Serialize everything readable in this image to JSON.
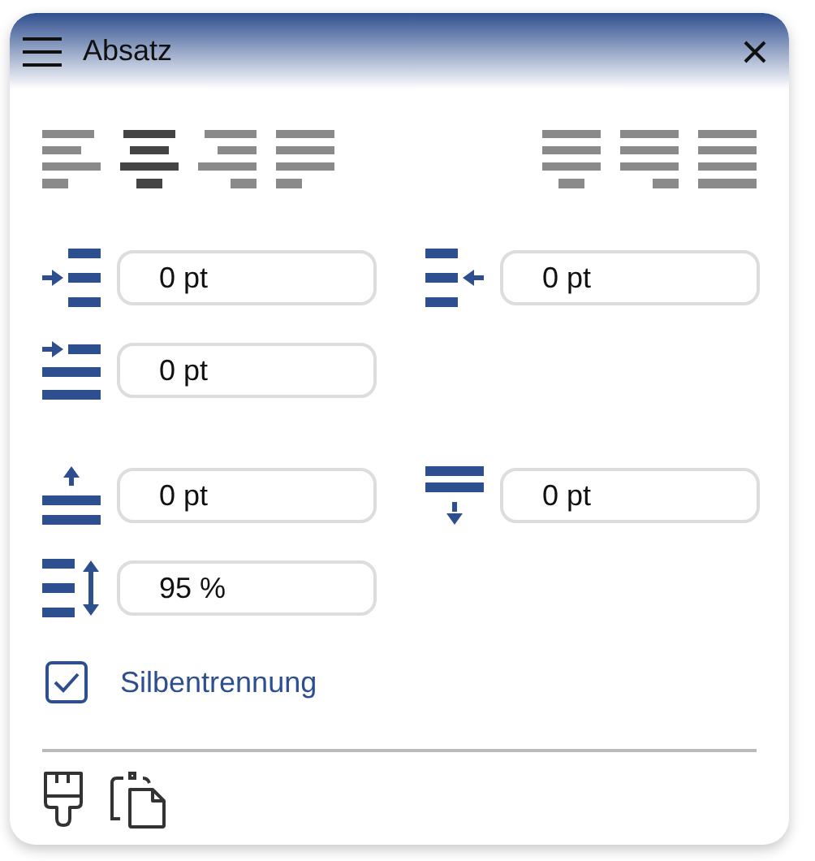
{
  "panel": {
    "title": "Absatz"
  },
  "alignment": [
    {
      "kind": "left",
      "selected": false
    },
    {
      "kind": "center",
      "selected": true
    },
    {
      "kind": "right",
      "selected": false
    },
    {
      "kind": "justify",
      "selected": false
    },
    {
      "kind": "justify-center",
      "selected": false
    },
    {
      "kind": "justify-right",
      "selected": false
    },
    {
      "kind": "justify-all",
      "selected": false
    }
  ],
  "spacing_groups": [
    [
      [
        {
          "kind": "indent-left",
          "value": "0 pt"
        },
        {
          "kind": "indent-right",
          "value": "0 pt"
        }
      ],
      [
        {
          "kind": "first-line",
          "value": "0 pt"
        }
      ]
    ],
    [
      [
        {
          "kind": "space-before",
          "value": "0 pt"
        },
        {
          "kind": "space-after",
          "value": "0 pt"
        }
      ],
      [
        {
          "kind": "line-spacing",
          "value": "95 %"
        }
      ]
    ]
  ],
  "hyphenation": {
    "label": "Silbentrennung",
    "checked": true
  },
  "tools": [
    {
      "kind": "brush"
    },
    {
      "kind": "clipboard"
    }
  ]
}
